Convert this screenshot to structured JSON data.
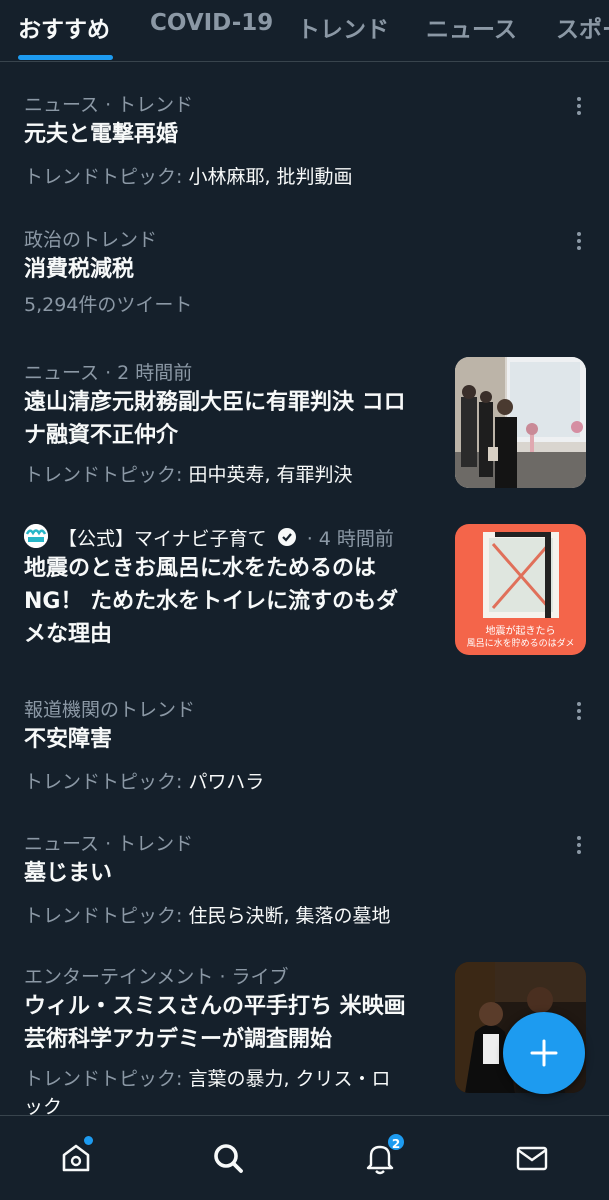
{
  "tabs": [
    "おすすめ",
    "COVID-19",
    "トレンド",
    "ニュース",
    "スポー"
  ],
  "items": [
    {
      "meta": "ニュース · トレンド",
      "title": "元夫と電撃再婚",
      "sub_label": "トレンドトピック: ",
      "sub_value": "小林麻耶, 批判動画"
    },
    {
      "meta": "政治のトレンド",
      "title": "消費税減税",
      "sub_label": "5,294件のツイート",
      "sub_value": ""
    },
    {
      "meta": "ニュース · 2 時間前",
      "title_lines": [
        "遠山清彦元財務副大臣に有罪判決 コロ",
        "ナ融資不正仲介"
      ],
      "sub_label": "トレンドトピック: ",
      "sub_value": "田中英寿, 有罪判決"
    },
    {
      "meta_name": "【公式】マイナビ子育て",
      "meta_time": "· 4 時間前",
      "title_lines": [
        "地震のときお風呂に水をためるのは",
        "NG！ ためた水をトイレに流すのもダ",
        "メな理由"
      ],
      "thumb_text_1": "地震が起きたら",
      "thumb_text_2": "風呂に水を貯めるのはダメ",
      "logo_text": "マイナビ"
    },
    {
      "meta": "報道機関のトレンド",
      "title": "不安障害",
      "sub_label": "トレンドトピック: ",
      "sub_value": "パワハラ"
    },
    {
      "meta": "ニュース · トレンド",
      "title": "墓じまい",
      "sub_label": "トレンドトピック: ",
      "sub_value": "住民ら決断, 集落の墓地"
    },
    {
      "meta": "エンターテインメント · ライブ",
      "title_lines": [
        "ウィル・スミスさんの平手打ち 米映画",
        "芸術科学アカデミーが調査開始"
      ],
      "sub_label": "トレンドトピック: ",
      "sub_value_lines": [
        "言葉の暴力, クリス・ロ",
        "ック"
      ]
    }
  ],
  "nav": {
    "notifications_badge": "2"
  },
  "colors": {
    "background": "#15202b",
    "accent": "#1d9bf0",
    "secondary_text": "#8b98a5",
    "primary_text": "#f7f9f9",
    "thumb_orange": "#f4654a"
  }
}
